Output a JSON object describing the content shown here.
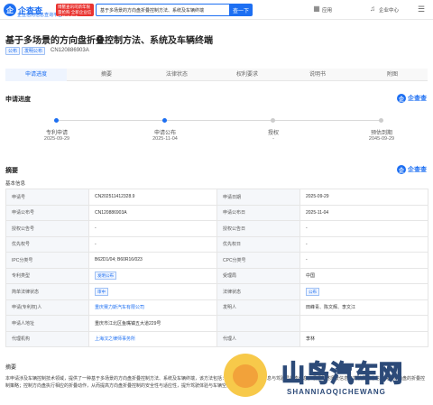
{
  "header": {
    "logo_char": "企",
    "logo_text": "企查查",
    "logo_sub": "企业信用信息查询平台",
    "promo_text": "博鳌查讯司新年限量抢购 全新企业信用等级查询",
    "search_value": "基于多场景的方向盘折叠控制方法、系统及车辆终端",
    "search_button": "查一下",
    "nav": [
      "应用",
      "企业中心"
    ],
    "nav_icons": [
      "grid-icon",
      "bell-icon",
      "menu-icon"
    ]
  },
  "title": "基于多场景的方向盘折叠控制方法、系统及车辆终端",
  "tags": [
    "公布",
    "发明公布"
  ],
  "patent_no": "CN120886903A",
  "tabs": [
    "申请进度",
    "摘要",
    "法律状态",
    "权利要求",
    "说明书",
    "附图"
  ],
  "progress": {
    "heading": "申请进度",
    "brand": "企查查",
    "steps": [
      {
        "label": "专利申请",
        "date": "2025-09-29",
        "done": true
      },
      {
        "label": "申请公布",
        "date": "2025-11-04",
        "done": true
      },
      {
        "label": "授权",
        "date": "-",
        "done": false
      },
      {
        "label": "预估到期",
        "date": "2045-09-29",
        "done": false
      }
    ]
  },
  "abstract_section": {
    "heading": "摘要",
    "brand": "企查查",
    "basic_info": "基本信息"
  },
  "info_rows": [
    {
      "k1": "申请号",
      "v1": "CN202511412328.9",
      "k2": "申请日期",
      "v2": "2025-09-29"
    },
    {
      "k1": "申请公布号",
      "v1": "CN120886903A",
      "k2": "申请公布日",
      "v2": "2025-11-04"
    },
    {
      "k1": "授权公告号",
      "v1": "-",
      "k2": "授权公告日",
      "v2": "-"
    },
    {
      "k1": "优先权号",
      "v1": "-",
      "k2": "优先权日",
      "v2": "-"
    },
    {
      "k1": "IPC分类号",
      "v1": "B62D1/04; B60R16/023",
      "k2": "CPC分类号",
      "v2": "-"
    },
    {
      "k1": "专利类型",
      "v1": "发明公布",
      "v1_tag": true,
      "k2": "受理局",
      "v2": "中国"
    },
    {
      "k1": "简单法律状态",
      "v1": "审中",
      "v1_tag": true,
      "k2": "法律状态",
      "v2": "公布",
      "v2_tag": true
    },
    {
      "k1": "申请(专利权)人",
      "v1": "重庆赛力斯汽车有限公司",
      "v1_link": true,
      "k2": "发明人",
      "v2": "田峰青、陈文辉、李文江"
    },
    {
      "k1": "申请人地址",
      "v1": "重庆市江北区鱼嘴镇五大道229号",
      "k2": "",
      "v2": ""
    },
    {
      "k1": "代理机构",
      "v1": "上海汉之律师事务所",
      "v1_link": true,
      "k2": "代理人",
      "v2": "李林"
    }
  ],
  "abstract": {
    "title": "摘要",
    "text": "本申请涉及车辆控制技术领域，提供了一种基于多场景的方向盘折叠控制方法、系统及车辆终端，该方法包括：获取车辆运行场景信息与驾驶员状态信息；根据所述场景信息与驾驶员状态信息确定方向盘的折叠控制策略；控制方向盘执行相应的折叠动作，从而提高方向盘折叠控制的安全性与适应性，提升驾驶体验与车辆空间利用率。"
  },
  "watermark": {
    "title": "山鸟汽车网",
    "sub": "SHANNIAOQICHEWANG"
  },
  "colors": {
    "accent": "#1d6ff2",
    "promo": "#e9322f"
  }
}
